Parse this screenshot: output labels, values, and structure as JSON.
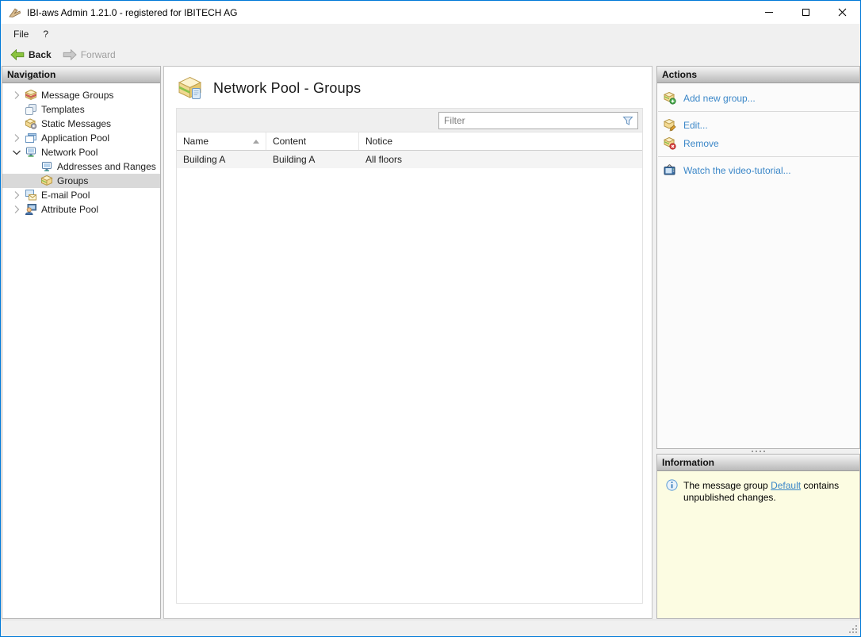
{
  "window": {
    "title": "IBI-aws Admin 1.21.0 - registered for IBITECH AG",
    "app_icon": "ibi-aws-logo-icon"
  },
  "menu": {
    "file_label": "File",
    "help_label": "?"
  },
  "toolbar": {
    "back_label": "Back",
    "forward_label": "Forward",
    "forward_enabled": false
  },
  "navigation": {
    "header": "Navigation",
    "items": [
      {
        "label": "Message Groups",
        "icon": "message-groups-icon",
        "expandable": true,
        "expanded": false,
        "indent": 0,
        "selected": false
      },
      {
        "label": "Templates",
        "icon": "templates-icon",
        "expandable": false,
        "indent": 0,
        "selected": false
      },
      {
        "label": "Static Messages",
        "icon": "static-messages-icon",
        "expandable": false,
        "indent": 0,
        "selected": false
      },
      {
        "label": "Application Pool",
        "icon": "application-pool-icon",
        "expandable": true,
        "expanded": false,
        "indent": 0,
        "selected": false
      },
      {
        "label": "Network Pool",
        "icon": "network-pool-icon",
        "expandable": true,
        "expanded": true,
        "indent": 0,
        "selected": false
      },
      {
        "label": "Addresses and Ranges",
        "icon": "addresses-ranges-icon",
        "expandable": false,
        "indent": 1,
        "selected": false
      },
      {
        "label": "Groups",
        "icon": "groups-icon",
        "expandable": false,
        "indent": 1,
        "selected": true
      },
      {
        "label": "E-mail Pool",
        "icon": "email-pool-icon",
        "expandable": true,
        "expanded": false,
        "indent": 0,
        "selected": false
      },
      {
        "label": "Attribute Pool",
        "icon": "attribute-pool-icon",
        "expandable": true,
        "expanded": false,
        "indent": 0,
        "selected": false
      }
    ]
  },
  "main": {
    "title": "Network Pool - Groups",
    "title_icon": "network-group-box-icon",
    "filter_placeholder": "Filter",
    "table": {
      "columns": [
        {
          "label": "Name",
          "sorted": "asc"
        },
        {
          "label": "Content"
        },
        {
          "label": "Notice"
        }
      ],
      "rows": [
        {
          "name": "Building A",
          "content": "Building A",
          "notice": "All floors"
        }
      ]
    }
  },
  "actions": {
    "header": "Actions",
    "items": [
      {
        "label": "Add new group...",
        "icon": "add-group-icon"
      },
      {
        "label": "Edit...",
        "icon": "edit-group-icon"
      },
      {
        "label": "Remove",
        "icon": "remove-group-icon"
      },
      {
        "label": "Watch the video-tutorial...",
        "icon": "video-tutorial-icon"
      }
    ]
  },
  "information": {
    "header": "Information",
    "message_prefix": "The message group ",
    "link_label": "Default",
    "message_suffix": " contains unpublished changes."
  },
  "colors": {
    "window_border": "#0079d8",
    "link": "#3b87c8",
    "selection_bg": "#d9d9d9",
    "info_panel_bg": "#fcfce2",
    "panel_header_gradient_top": "#f4f4f4",
    "panel_header_gradient_bottom": "#b9b9b9",
    "table_row_bg": "#f4f4f4",
    "back_arrow_green": "#8bc43f"
  }
}
